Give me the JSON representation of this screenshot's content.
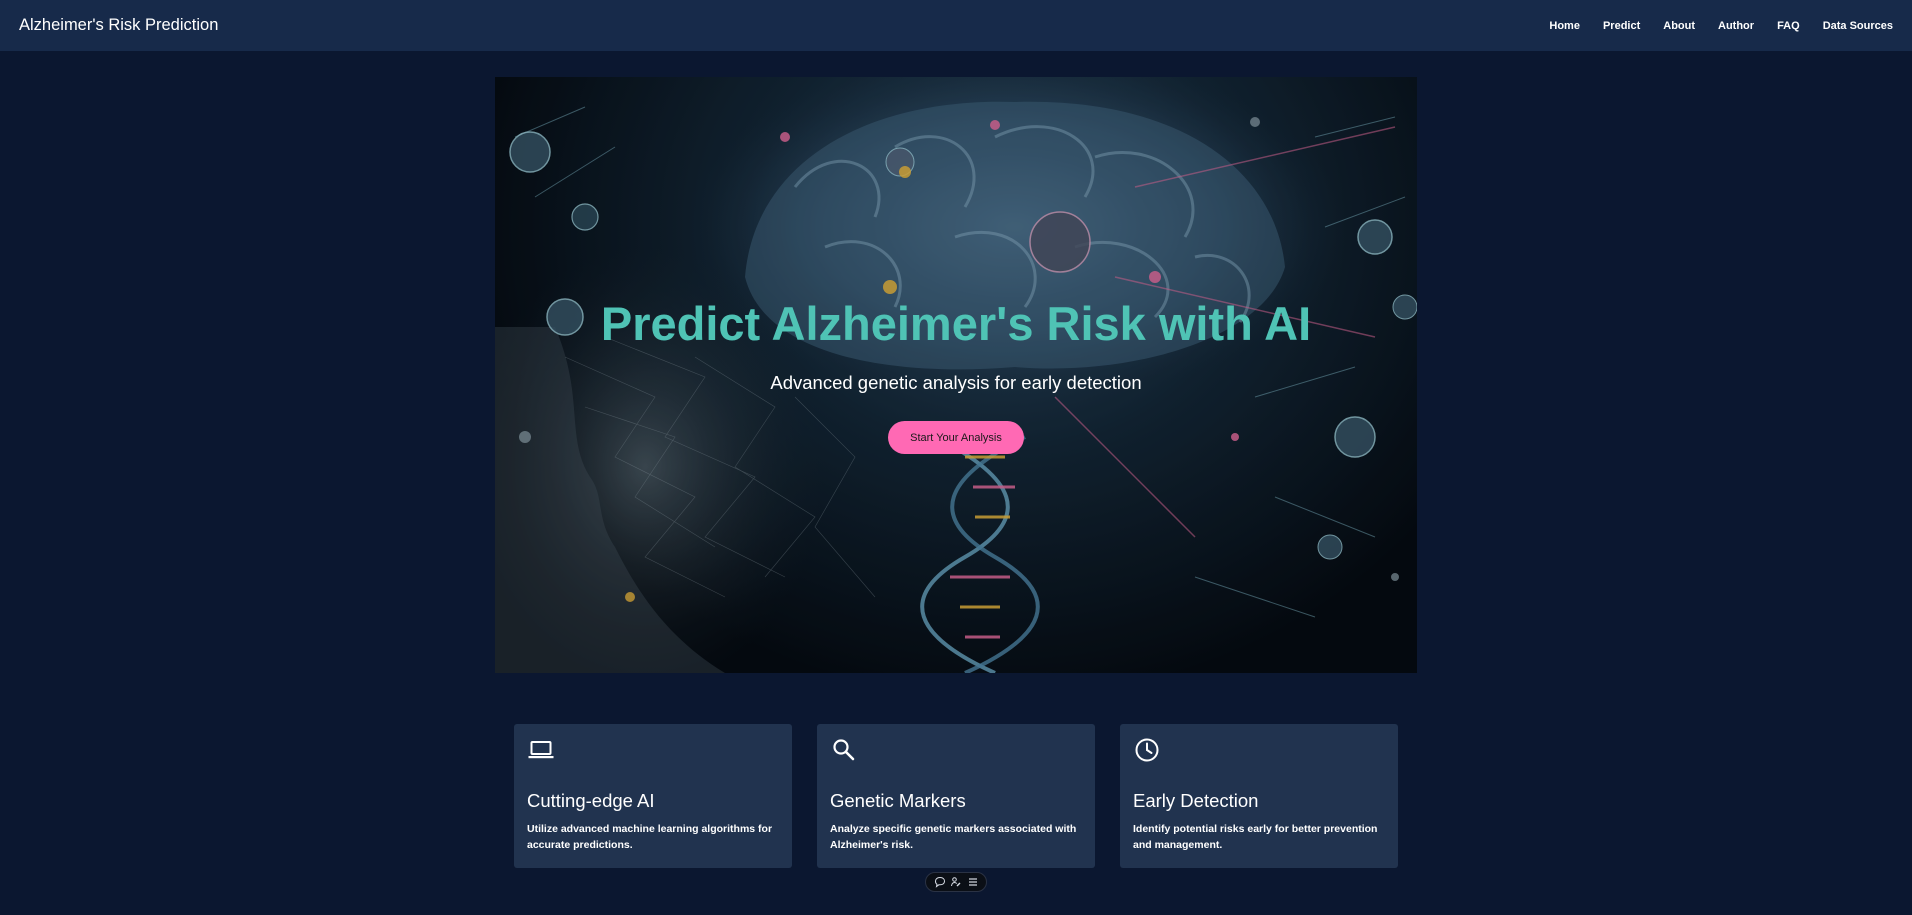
{
  "navbar": {
    "brand": "Alzheimer's Risk Prediction",
    "links": [
      "Home",
      "Predict",
      "About",
      "Author",
      "FAQ",
      "Data Sources"
    ]
  },
  "hero": {
    "title": "Predict Alzheimer's Risk with AI",
    "subtitle": "Advanced genetic analysis for early detection",
    "cta_label": "Start Your Analysis",
    "image_subject": "brain, human face wireframe and DNA helix illustration"
  },
  "features": [
    {
      "icon": "laptop-icon",
      "title": "Cutting-edge AI",
      "description": "Utilize advanced machine learning algorithms for accurate predictions."
    },
    {
      "icon": "search-icon",
      "title": "Genetic Markers",
      "description": "Analyze specific genetic markers associated with Alzheimer's risk."
    },
    {
      "icon": "clock-icon",
      "title": "Early Detection",
      "description": "Identify potential risks early for better prevention and management."
    }
  ],
  "floating_toolbar": {
    "icons": [
      "comment-icon",
      "person-edit-icon",
      "menu-icon"
    ]
  },
  "colors": {
    "background": "#0b1730",
    "navbar": "#172a4a",
    "card": "#21334f",
    "accent_teal": "#4fc3b5",
    "accent_pink": "#ff69b4"
  }
}
